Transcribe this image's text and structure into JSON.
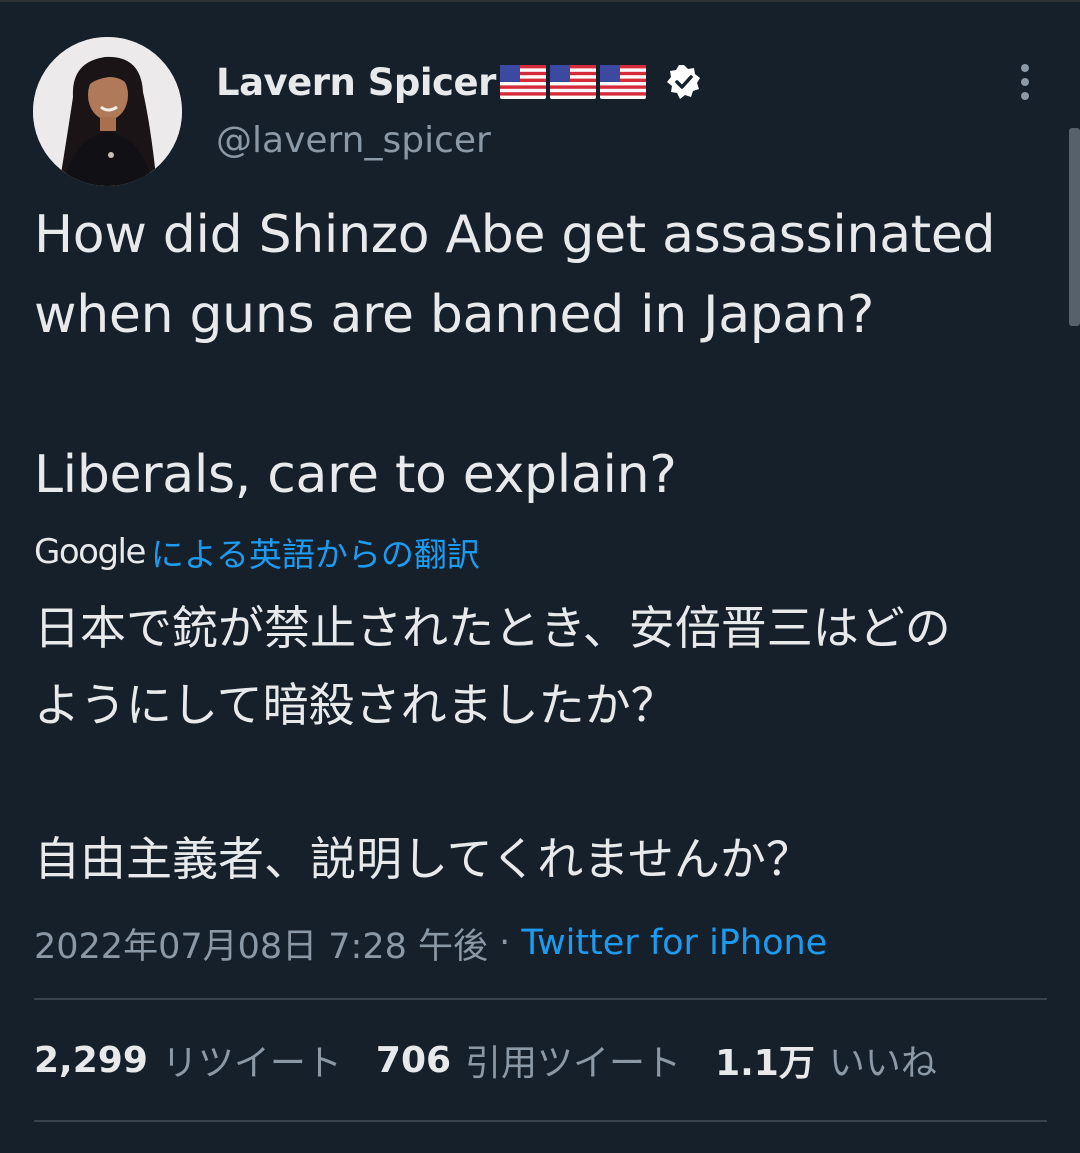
{
  "tweet": {
    "author": {
      "display_name": "Lavern Spicer",
      "handle": "@lavern_spicer",
      "flags": [
        "us-flag",
        "us-flag",
        "us-flag"
      ],
      "verified": true
    },
    "text_lines": [
      "How did Shinzo Abe get assassinated",
      "when guns are banned in Japan?",
      "Liberals, care to explain?"
    ],
    "translation": {
      "provider": "Google",
      "label": "による英語からの翻訳",
      "lines": [
        "日本で銃が禁止されたとき、安倍晋三はどの",
        "ようにして暗殺されましたか？",
        "自由主義者、説明してくれませんか？"
      ]
    },
    "meta": {
      "timestamp": "2022年07月08日 7:28 午後",
      "separator": " · ",
      "source": "Twitter for iPhone"
    },
    "stats": {
      "retweets": "2,299",
      "retweets_label": "リツイート",
      "quotes": "706",
      "quotes_label": "引用ツイート",
      "likes": "1.1万",
      "likes_label": "いいね"
    }
  },
  "colors": {
    "background": "#15202b",
    "text": "#e7e9ea",
    "secondary": "#8b98a5",
    "accent": "#1d9bf0",
    "divider": "#38444d"
  }
}
